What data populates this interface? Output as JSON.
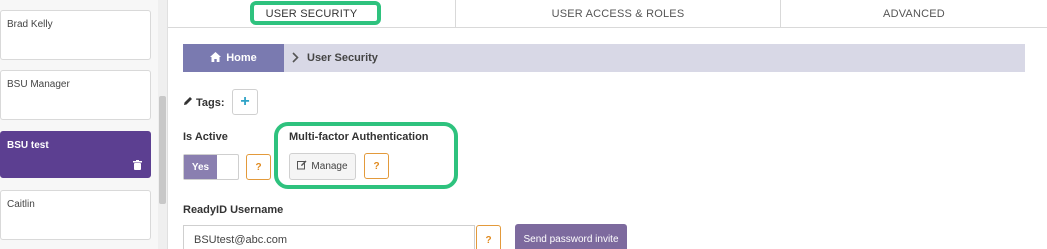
{
  "users": [
    {
      "name": "Brad Kelly",
      "active": false
    },
    {
      "name": "BSU Manager",
      "active": false
    },
    {
      "name": "BSU test",
      "active": true
    },
    {
      "name": "Caitlin",
      "active": false
    }
  ],
  "tabs": [
    {
      "label": "USER SECURITY",
      "active": true
    },
    {
      "label": "USER ACCESS & ROLES",
      "active": false
    },
    {
      "label": "ADVANCED",
      "active": false
    }
  ],
  "breadcrumb": {
    "home_label": "Home",
    "current": "User Security"
  },
  "tags": {
    "label": "Tags:",
    "add_symbol": "+"
  },
  "is_active": {
    "label": "Is Active",
    "toggle_label": "Yes",
    "help": "?"
  },
  "mfa": {
    "label": "Multi-factor Authentication",
    "manage_label": "Manage",
    "help": "?"
  },
  "readyid": {
    "label": "ReadyID Username",
    "value": "BSUtest@abc.com",
    "help": "?",
    "send_label": "Send password invite"
  },
  "colors": {
    "highlight": "#2ec27e",
    "active_user": "#5c3f91",
    "home_crumb": "#7a7ab0",
    "help_orange": "#e08a1f"
  }
}
